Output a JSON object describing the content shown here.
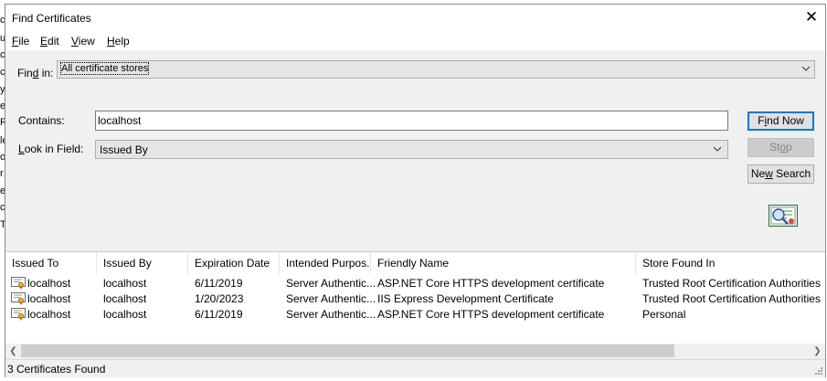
{
  "window": {
    "title": "Find Certificates",
    "close_glyph": "✕"
  },
  "menu": [
    {
      "accel": "F",
      "rest": "ile"
    },
    {
      "accel": "E",
      "rest": "dit"
    },
    {
      "accel": "V",
      "rest": "iew"
    },
    {
      "accel": "H",
      "rest": "elp"
    }
  ],
  "find_in": {
    "label_pre": "Fin",
    "label_accel": "d",
    "label_post": " in:",
    "value": "All certificate stores"
  },
  "contains": {
    "label": "Contains:",
    "value": "localhost"
  },
  "look_in_field": {
    "label_accel": "L",
    "label_rest": "ook in Field:",
    "value": "Issued By"
  },
  "buttons": {
    "find_now_pre": "F",
    "find_now_accel": "i",
    "find_now_post": "nd Now",
    "stop_pre": "St",
    "stop_accel": "o",
    "stop_post": "p",
    "new_search_pre": "Ne",
    "new_search_accel": "w",
    "new_search_post": " Search"
  },
  "table": {
    "headers": [
      "Issued To",
      "Issued By",
      "Expiration Date",
      "Intended Purpos...",
      "Friendly Name",
      "Store Found In"
    ],
    "rows": [
      [
        "localhost",
        "localhost",
        "6/11/2019",
        "Server Authentic...",
        "ASP.NET Core HTTPS development certificate",
        "Trusted Root Certification Authorities"
      ],
      [
        "localhost",
        "localhost",
        "1/20/2023",
        "Server Authentic...",
        "IIS Express Development Certificate",
        "Trusted Root Certification Authorities"
      ],
      [
        "localhost",
        "localhost",
        "6/11/2019",
        "Server Authentic...",
        "ASP.NET Core HTTPS development certificate",
        "Personal"
      ]
    ]
  },
  "status": {
    "text": "3 Certificates Found"
  },
  "background_fragments": [
    "c",
    "u",
    "c",
    "cc",
    "y",
    "e",
    "R",
    "le",
    "o",
    "r",
    "er",
    "c",
    "T"
  ],
  "colors": {
    "focus_border": "#0078d7",
    "window_bg": "#f0f0f0",
    "disabled_text": "#838383"
  },
  "icons": {
    "cert": "certificate-icon",
    "search": "search-certificates-icon"
  }
}
